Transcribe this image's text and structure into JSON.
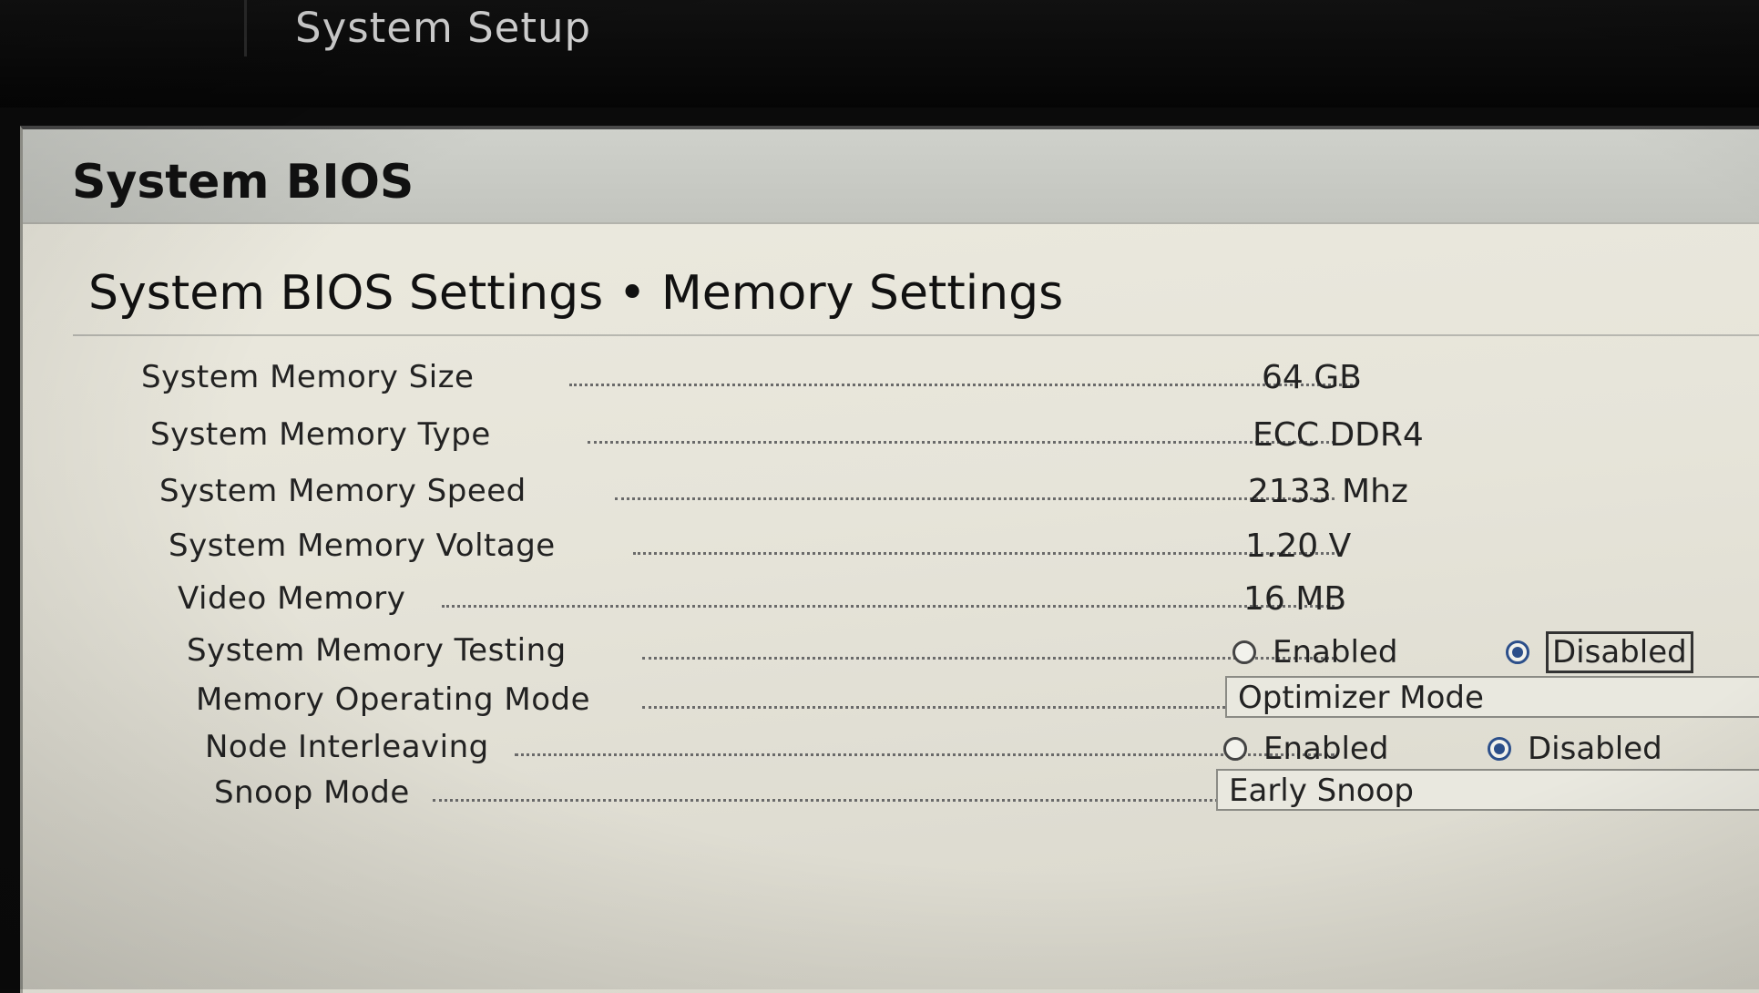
{
  "header": {
    "title": "System Setup"
  },
  "panel": {
    "title": "System BIOS",
    "breadcrumb": "System BIOS Settings • Memory Settings"
  },
  "settings": [
    {
      "label": "System Memory Size",
      "value": "64 GB"
    },
    {
      "label": "System Memory Type",
      "value": "ECC DDR4"
    },
    {
      "label": "System Memory Speed",
      "value": "2133 Mhz"
    },
    {
      "label": "System Memory Voltage",
      "value": "1.20 V"
    },
    {
      "label": "Video Memory",
      "value": "16 MB"
    },
    {
      "label": "System Memory Testing",
      "options": [
        "Enabled",
        "Disabled"
      ],
      "selected": "Disabled"
    },
    {
      "label": "Memory Operating Mode",
      "value": "Optimizer Mode"
    },
    {
      "label": "Node Interleaving",
      "options": [
        "Enabled",
        "Disabled"
      ],
      "selected": "Disabled"
    },
    {
      "label": "Snoop Mode",
      "value": "Early Snoop"
    }
  ],
  "colors": {
    "radio_selected": "#2c4f8a",
    "panel_background": "#e8e6db",
    "header_background": "#c8cac4",
    "top_bar": "#0b0b0b"
  }
}
